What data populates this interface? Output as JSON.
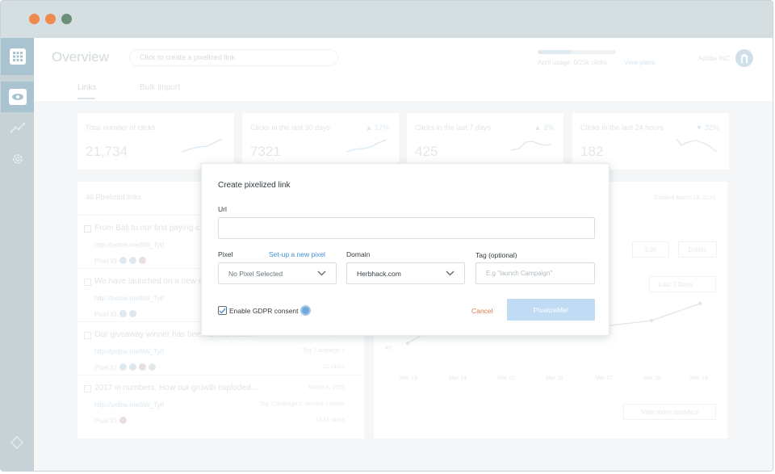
{
  "window": {
    "dots": [
      "close",
      "minimize",
      "maximize"
    ]
  },
  "sidebar": {
    "items": [
      {
        "icon": "grid-icon"
      },
      {
        "icon": "eye-icon"
      },
      {
        "icon": "analytics-icon"
      },
      {
        "icon": "gear-icon"
      }
    ],
    "bottom_icon": "diamond-icon"
  },
  "header": {
    "title": "Overview",
    "search_placeholder": "Click to create a pixelized link",
    "usage_text": "April usage: 0/20k clicks",
    "usage_fraction": 0.42,
    "view_plans": "View plans",
    "company": "Adobe INC",
    "tabs": [
      {
        "label": "Links"
      },
      {
        "label": "Bulk import"
      }
    ]
  },
  "cards": [
    {
      "label": "Total number of clicks",
      "value": "21,734",
      "delta": ""
    },
    {
      "label": "Clicks in the last 30 days",
      "value": "7321",
      "delta": "▲ 17%"
    },
    {
      "label": "Clicks in the last 7 days",
      "value": "425",
      "delta": "▲ 3%"
    },
    {
      "label": "Clicks in the last 24 hours",
      "value": "182",
      "delta": "▼ 32%"
    }
  ],
  "links_panel": {
    "count": "46",
    "heading_suffix": "Pixelized links",
    "items": [
      {
        "title": "From Bali to our first paying c...",
        "url": "http://pxlme.me/bW_Tyif",
        "pixel": "Pixel ID:",
        "meta": "",
        "clicks": ""
      },
      {
        "title": "We have launched on a new e...",
        "url": "http://pxlme.me/bW_Tyif",
        "pixel": "Pixel ID:",
        "meta": "",
        "clicks": ""
      },
      {
        "title": "Our giveaway winner has been announced...",
        "url": "http://pxlme.me/bW_Tyif",
        "pixel": "Pixel ID:",
        "meta": "Tag: Campaign 1",
        "clicks": "22 clicks"
      },
      {
        "title": "2017 in numbers. How our growth exploded...",
        "url": "http://pxlme.me/bW_Tyif",
        "pixel": "Pixel ID:",
        "meta": "Tag: Campaign 1, movies, Launch",
        "clicks": "15.1k clicks"
      }
    ],
    "dates": [
      "",
      "",
      "March 5, 2018",
      "March 5, 2018"
    ]
  },
  "detail_panel": {
    "created": "Created March 13, 2018",
    "edit": "Edit",
    "delete": "Delete",
    "range": "Last 7 Days",
    "view_more": "View more analytics",
    "x_labels": [
      "Mar 13",
      "Mar 14",
      "Mar 15",
      "Mar 16",
      "Mar 17",
      "Mar 18",
      "Mar 19"
    ],
    "y_labels": [
      "30",
      "40"
    ]
  },
  "modal": {
    "title": "Create pixelized link",
    "url_label": "Url",
    "url_value": "",
    "pixel_label": "Pixel",
    "setup_link": "Set-up a new pixel",
    "pixel_value": "No Pixel Selected",
    "domain_label": "Domain",
    "domain_value": "Herbhack.com",
    "tag_label": "Tag (optional)",
    "tag_placeholder": "E.g \"launch Campaign\"",
    "gdpr_label": "Enable GDPR consent",
    "gdpr_checked": true,
    "cancel": "Cancel",
    "submit": "PixelizeMe!"
  }
}
